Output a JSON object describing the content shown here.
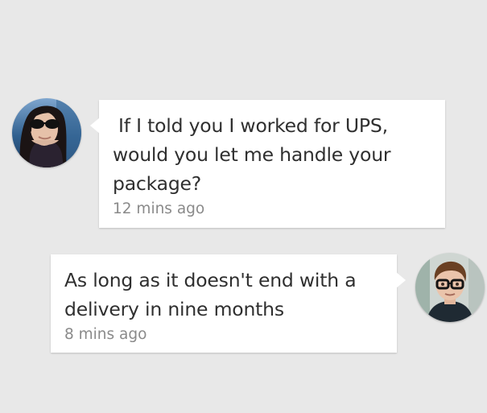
{
  "messages": [
    {
      "sender": "left",
      "text": "If I told you I worked for UPS, would you let me handle your package?",
      "time": "12 mins ago"
    },
    {
      "sender": "right",
      "text": "As long as it doesn't end with a delivery in nine months",
      "time": "8 mins ago"
    }
  ],
  "colors": {
    "background": "#e8e8e8",
    "bubble": "#ffffff",
    "text": "#2f2f2f",
    "timestamp": "#8a8a8a"
  }
}
